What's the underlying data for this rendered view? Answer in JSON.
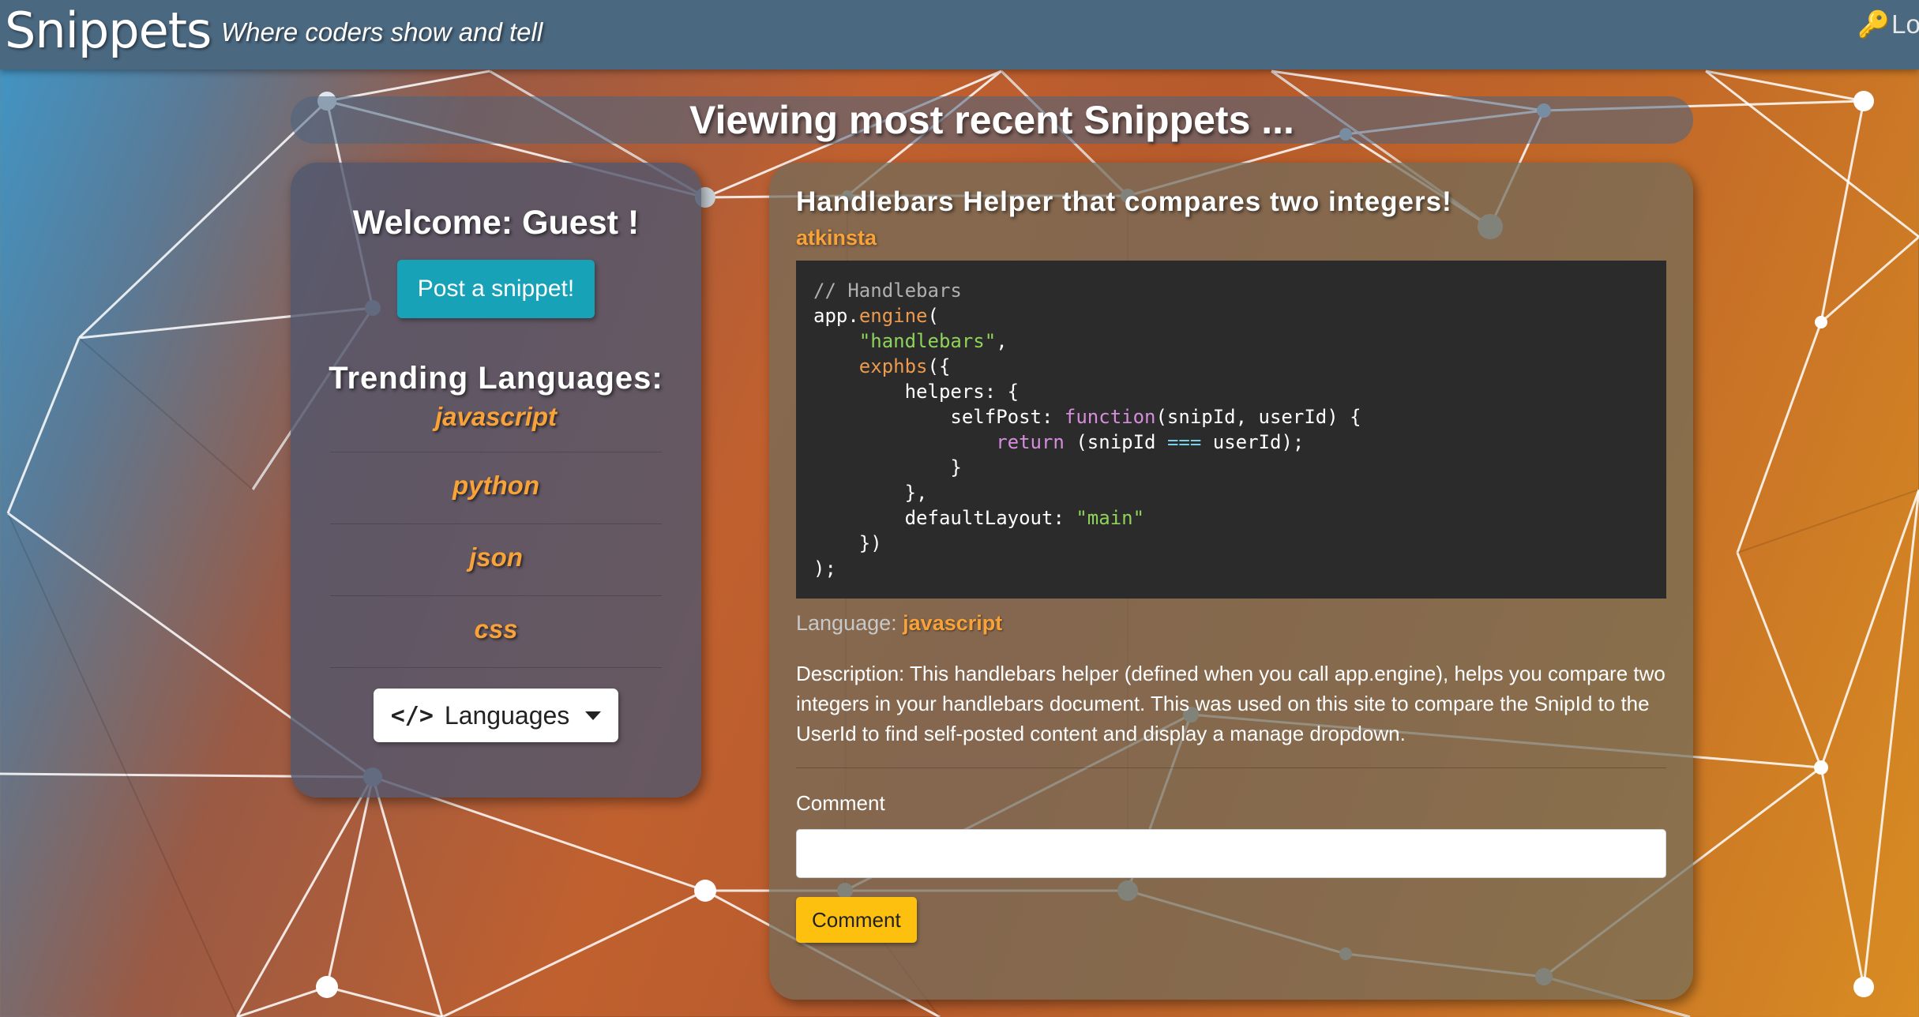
{
  "navbar": {
    "brand": "Snippets",
    "tagline": "Where coders show and tell",
    "login_label": "Log"
  },
  "heading": "Viewing most recent Snippets ...",
  "sidebar": {
    "welcome": "Welcome: Guest !",
    "post_button": "Post a snippet!",
    "trending_title": "Trending Languages:",
    "languages": [
      "javascript",
      "python",
      "json",
      "css"
    ],
    "languages_dropdown": "Languages"
  },
  "snippet": {
    "title": "Handlebars Helper that compares two integers!",
    "author": "atkinsta",
    "code_lines": [
      [
        {
          "t": "comment",
          "v": "// Handlebars"
        }
      ],
      [
        {
          "t": "prop",
          "v": "app"
        },
        {
          "t": "plain",
          "v": "."
        },
        {
          "t": "fn",
          "v": "engine"
        },
        {
          "t": "plain",
          "v": "("
        }
      ],
      [
        {
          "t": "plain",
          "v": "    "
        },
        {
          "t": "str",
          "v": "\"handlebars\""
        },
        {
          "t": "plain",
          "v": ","
        }
      ],
      [
        {
          "t": "plain",
          "v": "    "
        },
        {
          "t": "fn",
          "v": "exphbs"
        },
        {
          "t": "plain",
          "v": "({"
        }
      ],
      [
        {
          "t": "plain",
          "v": "        "
        },
        {
          "t": "prop",
          "v": "helpers"
        },
        {
          "t": "plain",
          "v": ": {"
        }
      ],
      [
        {
          "t": "plain",
          "v": "            "
        },
        {
          "t": "prop",
          "v": "selfPost"
        },
        {
          "t": "plain",
          "v": ": "
        },
        {
          "t": "kw",
          "v": "function"
        },
        {
          "t": "plain",
          "v": "(snipId, userId) {"
        }
      ],
      [
        {
          "t": "plain",
          "v": "                "
        },
        {
          "t": "kw",
          "v": "return"
        },
        {
          "t": "plain",
          "v": " (snipId "
        },
        {
          "t": "op",
          "v": "==="
        },
        {
          "t": "plain",
          "v": " userId);"
        }
      ],
      [
        {
          "t": "plain",
          "v": "            }"
        }
      ],
      [
        {
          "t": "plain",
          "v": "        },"
        }
      ],
      [
        {
          "t": "plain",
          "v": "        "
        },
        {
          "t": "prop",
          "v": "defaultLayout"
        },
        {
          "t": "plain",
          "v": ": "
        },
        {
          "t": "str",
          "v": "\"main\""
        }
      ],
      [
        {
          "t": "plain",
          "v": "    })"
        }
      ],
      [
        {
          "t": "plain",
          "v": ");"
        }
      ]
    ],
    "language_label": "Language:",
    "language_value": "javascript",
    "description": "Description: This handlebars helper (defined when you call app.engine), helps you compare two integers in your handlebars document. This was used on this site to compare the SnipId to the UserId to find self-posted content and display a manage dropdown.",
    "comment_label": "Comment",
    "comment_value": "",
    "comment_button": "Comment"
  },
  "colors": {
    "navbar": "#4a6880",
    "accent_orange": "#f8a23a",
    "post_button": "#17a2b8",
    "comment_button": "#fec00f",
    "code_bg": "#2b2b2b"
  }
}
